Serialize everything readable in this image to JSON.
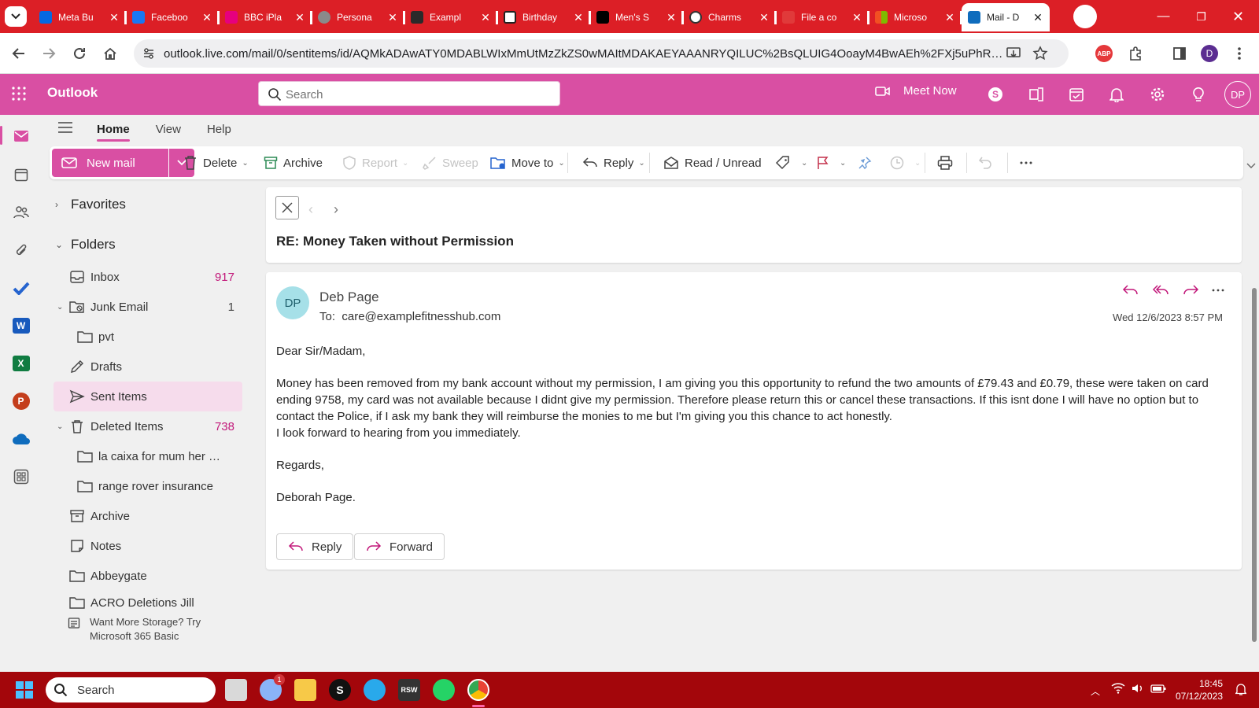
{
  "browser": {
    "tabs": [
      {
        "title": "Meta Bu",
        "color": "#0668e1"
      },
      {
        "title": "Faceboo",
        "color": "#1877f2"
      },
      {
        "title": "BBC iPla",
        "color": "#e6007e"
      },
      {
        "title": "Persona",
        "color": "#8a8a8a"
      },
      {
        "title": "Exampl",
        "color": "#2a2a2a"
      },
      {
        "title": "Birthday",
        "color": "#222222"
      },
      {
        "title": "Men's S",
        "color": "#000000"
      },
      {
        "title": "Charms",
        "color": "#333333"
      },
      {
        "title": "File a co",
        "color": "#e03a3a"
      },
      {
        "title": "Microso",
        "color": "#f25022"
      },
      {
        "title": "Mail - D",
        "color": "#0f6cbd"
      }
    ],
    "url": "outlook.live.com/mail/0/sentitems/id/AQMkADAwATY0MDABLWIxMmUtMzZkZS0wMAItMDAKAEYAAANRYQILUC%2BsQLUIG4OoayM4BwAEh%2FXj5uPhRJII4t5cl...",
    "profile_initial": "D"
  },
  "header": {
    "app_name": "Outlook",
    "search_placeholder": "Search",
    "meet_now": "Meet Now",
    "user_initials": "DP",
    "accent": "#d94fa3"
  },
  "ribbon_tabs": [
    "Home",
    "View",
    "Help"
  ],
  "toolbar": {
    "new_mail": "New mail",
    "delete": "Delete",
    "archive": "Archive",
    "report": "Report",
    "sweep": "Sweep",
    "move_to": "Move to",
    "reply": "Reply",
    "read_unread": "Read / Unread"
  },
  "folders": {
    "favorites": "Favorites",
    "folders_heading": "Folders",
    "items": [
      {
        "label": "Inbox",
        "count": "917"
      },
      {
        "label": "Junk Email",
        "count": "1"
      },
      {
        "label": "pvt",
        "count": ""
      },
      {
        "label": "Drafts",
        "count": ""
      },
      {
        "label": "Sent Items",
        "count": ""
      },
      {
        "label": "Deleted Items",
        "count": "738"
      },
      {
        "label": "la caixa for mum her n...",
        "count": ""
      },
      {
        "label": "range rover insurance",
        "count": ""
      },
      {
        "label": "Archive",
        "count": ""
      },
      {
        "label": "Notes",
        "count": ""
      },
      {
        "label": "Abbeygate",
        "count": ""
      },
      {
        "label": "ACRO Deletions Jill",
        "count": ""
      }
    ],
    "storage_line1": "Want More Storage? Try",
    "storage_line2": "Microsoft 365 Basic"
  },
  "message": {
    "subject": "RE: Money Taken without Permission",
    "sender_initials": "DP",
    "sender": "Deb Page",
    "to_label": "To:",
    "to": "care@examplefitnesshub.com",
    "date": "Wed 12/6/2023 8:57 PM",
    "greeting": "Dear Sir/Madam,",
    "body": "Money has been removed from my bank account without my permission, I am giving you this opportunity to refund the two amounts of £79.43 and £0.79, these were taken on card ending 9758, my card was not available because I didnt give my permission. Therefore please return this or cancel these transactions. If this isnt done I will have no option but to contact the Police, if I ask my bank they will reimburse the monies to me but I'm giving you this chance to act honestly.",
    "body2": "I look forward to hearing from you immediately.",
    "closing": "Regards,",
    "signature": "Deborah Page.",
    "reply_btn": "Reply",
    "forward_btn": "Forward"
  },
  "taskbar": {
    "search": "Search",
    "time": "18:45",
    "date": "07/12/2023",
    "onedrive_badge": "1"
  }
}
